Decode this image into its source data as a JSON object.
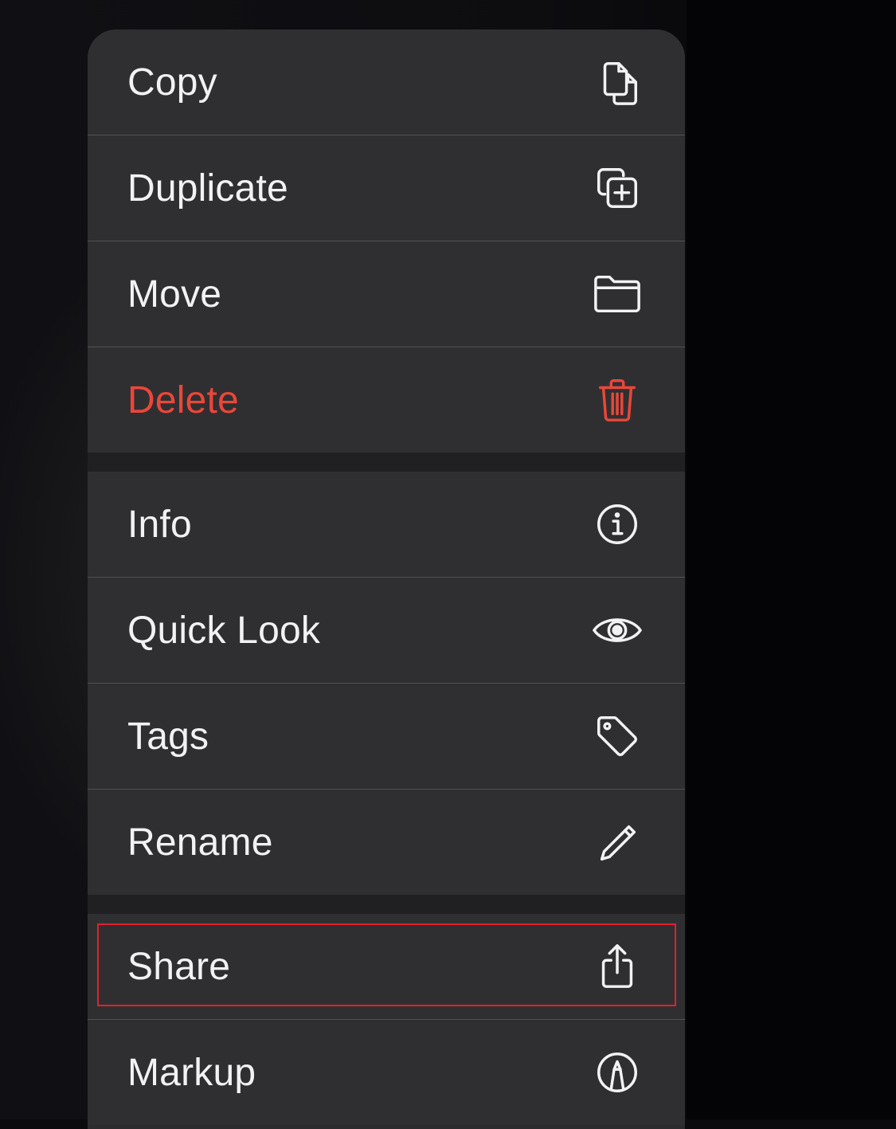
{
  "menu": {
    "groups": [
      {
        "items": [
          {
            "label": "Copy",
            "icon": "copy-icon"
          },
          {
            "label": "Duplicate",
            "icon": "duplicate-icon"
          },
          {
            "label": "Move",
            "icon": "folder-icon"
          },
          {
            "label": "Delete",
            "icon": "trash-icon",
            "destructive": true
          }
        ]
      },
      {
        "items": [
          {
            "label": "Info",
            "icon": "info-icon"
          },
          {
            "label": "Quick Look",
            "icon": "eye-icon"
          },
          {
            "label": "Tags",
            "icon": "tag-icon"
          },
          {
            "label": "Rename",
            "icon": "pencil-icon"
          }
        ]
      },
      {
        "items": [
          {
            "label": "Share",
            "icon": "share-icon",
            "highlighted": true
          },
          {
            "label": "Markup",
            "icon": "markup-icon"
          }
        ]
      }
    ]
  },
  "colors": {
    "menu_background": "#2c2c2e",
    "text": "#f2f2f4",
    "destructive": "#eb4639",
    "highlight_outline": "#e0202e"
  }
}
